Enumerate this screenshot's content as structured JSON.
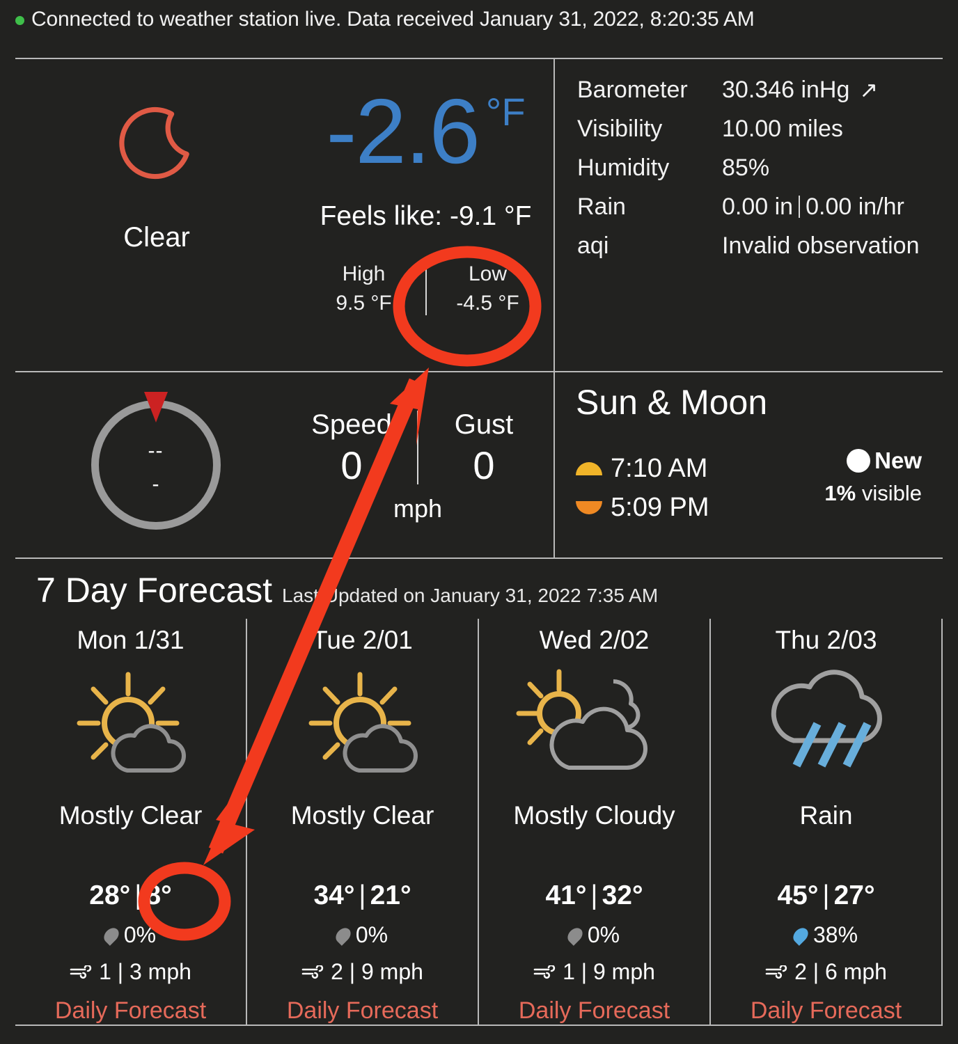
{
  "status": {
    "dot_color": "#3fbf4a",
    "text": "Connected to weather station live. Data received January 31, 2022, 8:20:35 AM"
  },
  "current": {
    "icon": "crescent-moon-icon",
    "condition": "Clear",
    "temperature": "-2.6",
    "unit": "°F",
    "feels_like": "Feels like: -9.1 °F",
    "high_label": "High",
    "high_value": "9.5 °F",
    "low_label": "Low",
    "low_value": "-4.5 °F",
    "temp_color": "#3d7fc6"
  },
  "metrics": [
    {
      "key": "Barometer",
      "value": "30.346 inHg",
      "trend": "↗"
    },
    {
      "key": "Visibility",
      "value": "10.00 miles",
      "trend": ""
    },
    {
      "key": "Humidity",
      "value": "85%",
      "trend": ""
    },
    {
      "key": "Rain",
      "value": "0.00 in",
      "value2": "0.00 in/hr",
      "trend": ""
    },
    {
      "key": "aqi",
      "value": "Invalid observation",
      "trend": ""
    }
  ],
  "wind": {
    "direction": "--",
    "degrees": "-",
    "speed_label": "Speed",
    "speed_value": "0",
    "gust_label": "Gust",
    "gust_value": "0",
    "unit": "mph"
  },
  "sunmoon": {
    "title": "Sun & Moon",
    "sunrise": "7:10 AM",
    "sunset": "5:09 PM",
    "moon_phase": "New",
    "moon_visible_pct": "1%",
    "moon_visible_label": "visible"
  },
  "forecast": {
    "title": "7 Day Forecast",
    "updated": "Last Updated on January 31, 2022 7:35 AM",
    "link_label": "Daily Forecast",
    "link_color": "#e66a5a",
    "cards": [
      {
        "day": "Mon 1/31",
        "icon": "sun-behind-cloud-icon",
        "condition": "Mostly Clear",
        "high": "28°",
        "low": "8°",
        "pop": "0%",
        "pop_color": "#8c8c8c",
        "wind": "1 | 3 mph"
      },
      {
        "day": "Tue 2/01",
        "icon": "sun-behind-cloud-icon",
        "condition": "Mostly Clear",
        "high": "34°",
        "low": "21°",
        "pop": "0%",
        "pop_color": "#8c8c8c",
        "wind": "2 | 9 mph"
      },
      {
        "day": "Wed 2/02",
        "icon": "sun-behind-large-cloud-icon",
        "condition": "Mostly Cloudy",
        "high": "41°",
        "low": "32°",
        "pop": "0%",
        "pop_color": "#8c8c8c",
        "wind": "1 | 9 mph"
      },
      {
        "day": "Thu 2/03",
        "icon": "rain-cloud-icon",
        "condition": "Rain",
        "high": "45°",
        "low": "27°",
        "pop": "38%",
        "pop_color": "#54a9e0",
        "wind": "2 | 6 mph"
      }
    ]
  },
  "annotations": {
    "color": "#f23a1e",
    "ellipse_low_temp": "circles the Low -4.5 °F reading",
    "ellipse_forecast_low": "circles the 8° forecast low",
    "arrow": "points from the Low reading down to the Mon 1/31 forecast low"
  }
}
